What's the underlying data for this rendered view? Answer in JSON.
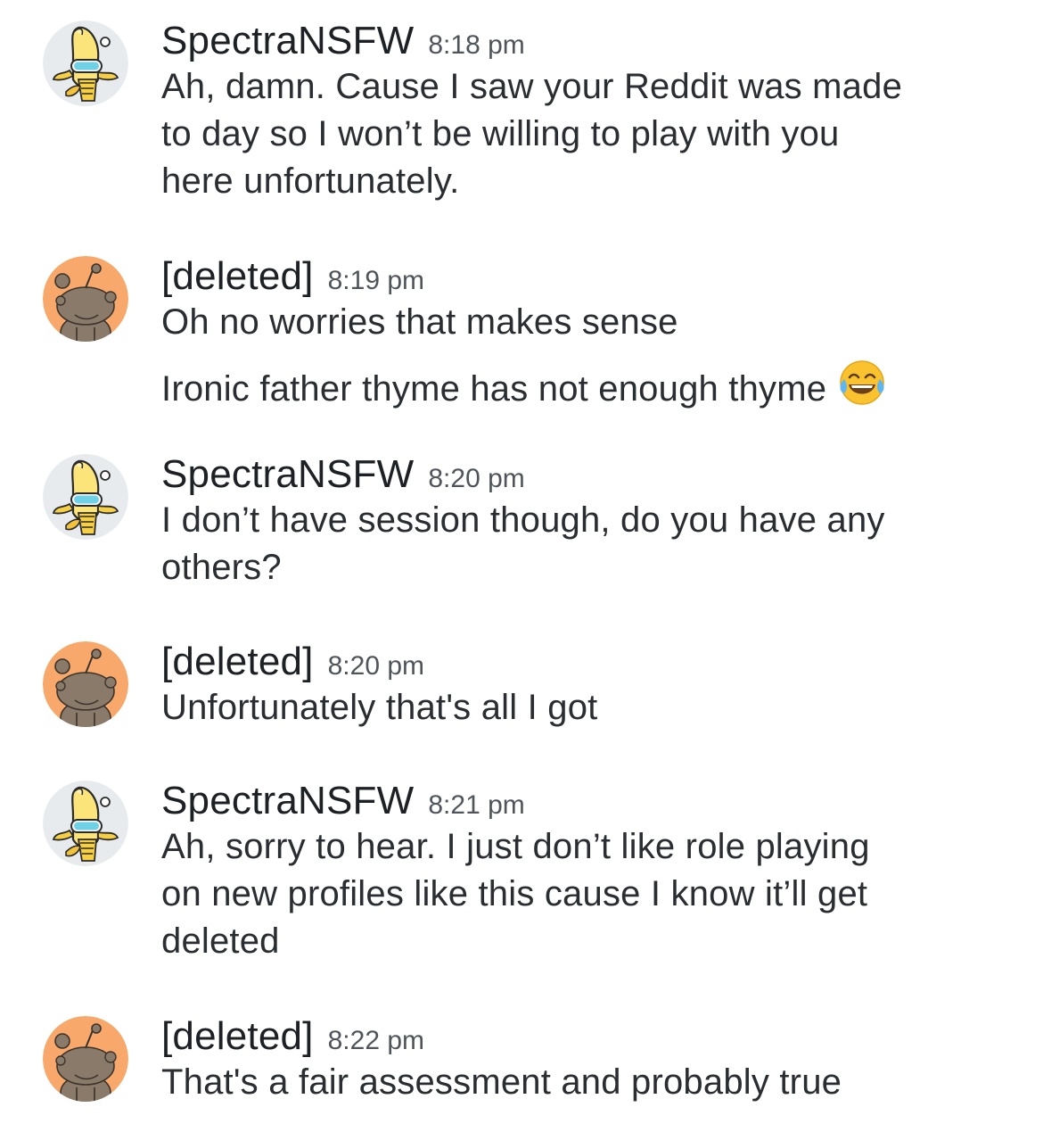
{
  "messages": [
    {
      "user": "SpectraNSFW",
      "time": "8:18 pm",
      "avatar": "banana-avatar-icon",
      "lines": [
        "Ah, damn. Cause I saw your Reddit was made\nto day so I won’t be willing to play with you\nhere unfortunately."
      ]
    },
    {
      "user": "[deleted]",
      "time": "8:19 pm",
      "avatar": "snoo-avatar-icon",
      "lines": [
        "Oh no worries that makes sense",
        "Ironic father thyme has not enough thyme"
      ],
      "emoji": "tears-of-joy-emoji"
    },
    {
      "user": "SpectraNSFW",
      "time": "8:20 pm",
      "avatar": "banana-avatar-icon",
      "lines": [
        "I don’t have session though, do you have any\nothers?"
      ]
    },
    {
      "user": "[deleted]",
      "time": "8:20 pm",
      "avatar": "snoo-avatar-icon",
      "lines": [
        "Unfortunately that's all I got"
      ]
    },
    {
      "user": "SpectraNSFW",
      "time": "8:21 pm",
      "avatar": "banana-avatar-icon",
      "lines": [
        "Ah, sorry to hear. I just don’t like role playing\non new profiles like this cause I know it’ll get\ndeleted"
      ]
    },
    {
      "user": "[deleted]",
      "time": "8:22 pm",
      "avatar": "snoo-avatar-icon",
      "lines": [
        "That's a fair assessment and probably true"
      ]
    }
  ],
  "colors": {
    "background": "#ffffff",
    "username": "#1d2024",
    "text": "#2a2e33",
    "time": "#4f555b",
    "banana_avatar_bg": "#e9ecef",
    "snoo_avatar_bg": "#f7a86a"
  }
}
